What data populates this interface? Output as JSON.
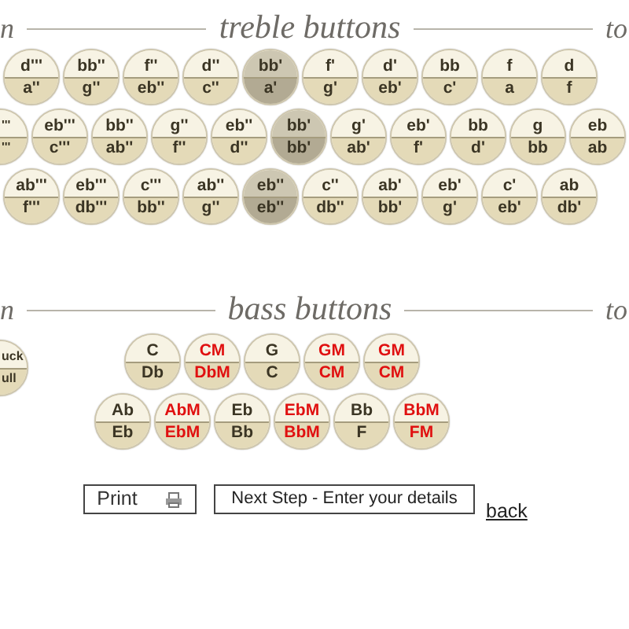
{
  "treble": {
    "lead_fragment": "n",
    "title": "treble buttons",
    "trail_fragment": "to",
    "rows": [
      [
        {
          "top": "d'''",
          "bottom": "a''",
          "selected": false
        },
        {
          "top": "bb''",
          "bottom": "g''",
          "selected": false
        },
        {
          "top": "f''",
          "bottom": "eb''",
          "selected": false
        },
        {
          "top": "d''",
          "bottom": "c''",
          "selected": false
        },
        {
          "top": "bb'",
          "bottom": "a'",
          "selected": true
        },
        {
          "top": "f'",
          "bottom": "g'",
          "selected": false
        },
        {
          "top": "d'",
          "bottom": "eb'",
          "selected": false
        },
        {
          "top": "bb",
          "bottom": "c'",
          "selected": false
        },
        {
          "top": "f",
          "bottom": "a",
          "selected": false
        },
        {
          "top": "d",
          "bottom": "f",
          "selected": false
        }
      ],
      [
        {
          "top": "'''",
          "bottom": "'''",
          "selected": false
        },
        {
          "top": "eb'''",
          "bottom": "c'''",
          "selected": false
        },
        {
          "top": "bb''",
          "bottom": "ab''",
          "selected": false
        },
        {
          "top": "g''",
          "bottom": "f''",
          "selected": false
        },
        {
          "top": "eb''",
          "bottom": "d''",
          "selected": false
        },
        {
          "top": "bb'",
          "bottom": "bb'",
          "selected": true
        },
        {
          "top": "g'",
          "bottom": "ab'",
          "selected": false
        },
        {
          "top": "eb'",
          "bottom": "f'",
          "selected": false
        },
        {
          "top": "bb",
          "bottom": "d'",
          "selected": false
        },
        {
          "top": "g",
          "bottom": "bb",
          "selected": false
        },
        {
          "top": "eb",
          "bottom": "ab",
          "selected": false
        }
      ],
      [
        {
          "top": "ab'''",
          "bottom": "f'''",
          "selected": false
        },
        {
          "top": "eb'''",
          "bottom": "db'''",
          "selected": false
        },
        {
          "top": "c'''",
          "bottom": "bb''",
          "selected": false
        },
        {
          "top": "ab''",
          "bottom": "g''",
          "selected": false
        },
        {
          "top": "eb''",
          "bottom": "eb''",
          "selected": true
        },
        {
          "top": "c''",
          "bottom": "db''",
          "selected": false
        },
        {
          "top": "ab'",
          "bottom": "bb'",
          "selected": false
        },
        {
          "top": "eb'",
          "bottom": "g'",
          "selected": false
        },
        {
          "top": "c'",
          "bottom": "eb'",
          "selected": false
        },
        {
          "top": "ab",
          "bottom": "db'",
          "selected": false
        }
      ]
    ]
  },
  "bass": {
    "lead_fragment": "n",
    "title": "bass buttons",
    "trail_fragment": "to",
    "partial_button": {
      "top": "uck",
      "bottom": "ull"
    },
    "rows": [
      [
        {
          "top": "C",
          "bottom": "Db",
          "highlighted": false
        },
        {
          "top": "CM",
          "bottom": "DbM",
          "highlighted": true
        },
        {
          "top": "G",
          "bottom": "C",
          "highlighted": false
        },
        {
          "top": "GM",
          "bottom": "CM",
          "highlighted": true
        },
        {
          "top": "GM",
          "bottom": "CM",
          "highlighted": true
        }
      ],
      [
        {
          "top": "Ab",
          "bottom": "Eb",
          "highlighted": false
        },
        {
          "top": "AbM",
          "bottom": "EbM",
          "highlighted": true
        },
        {
          "top": "Eb",
          "bottom": "Bb",
          "highlighted": false
        },
        {
          "top": "EbM",
          "bottom": "BbM",
          "highlighted": true
        },
        {
          "top": "Bb",
          "bottom": "F",
          "highlighted": false
        },
        {
          "top": "BbM",
          "bottom": "FM",
          "highlighted": true
        }
      ]
    ]
  },
  "actions": {
    "print": "Print",
    "next": "Next Step - Enter your details",
    "back": "back"
  }
}
